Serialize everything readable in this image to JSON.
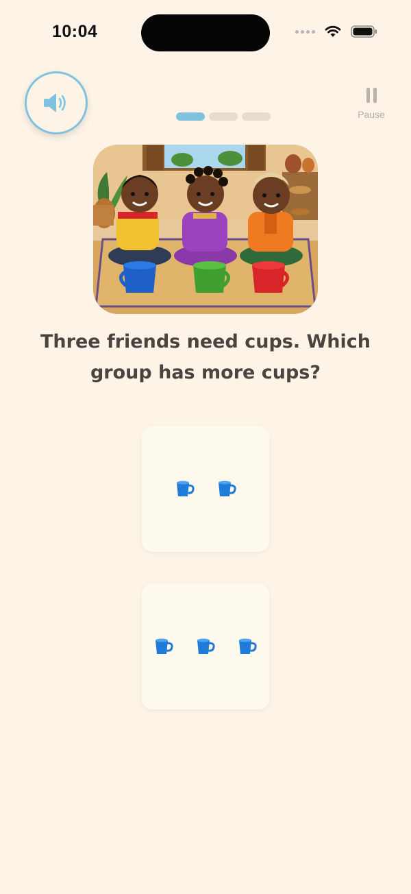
{
  "status_bar": {
    "time": "10:04"
  },
  "icons": {
    "speaker": "speaker-icon",
    "pause": "pause-icon",
    "cup": "cup-icon",
    "wifi": "wifi-icon",
    "battery": "battery-icon",
    "signal": "cellular-signal-icon"
  },
  "controls": {
    "pause_label": "Pause"
  },
  "progress": {
    "total_steps": 3,
    "current_step": 1
  },
  "illustration": {
    "subject": "three-children-with-blue-green-red-cups"
  },
  "question": {
    "text": "Three friends need cups. Which group has more cups?"
  },
  "options": [
    {
      "cup_count": 2
    },
    {
      "cup_count": 3
    }
  ],
  "colors": {
    "background": "#FDF4E7",
    "accent": "#7FC2DE",
    "card": "#FFF9EE",
    "text": "#4a4340",
    "cup_blue": "#1E7BD8"
  }
}
